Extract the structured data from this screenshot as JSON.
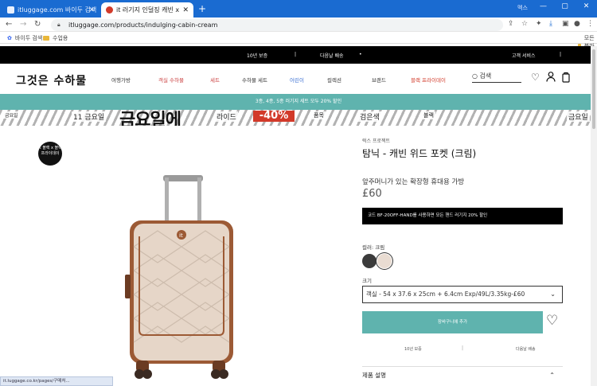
{
  "browser": {
    "tabs": [
      {
        "title": "itluggage.com 바이두 검색",
        "active": false
      },
      {
        "title": "it 러기지 인덜징 캐빈 x",
        "active": true
      }
    ],
    "new_tab": "+",
    "profile_label": "멕스",
    "window_controls": [
      "—",
      "▢",
      "✕"
    ],
    "url": "itluggage.com/products/indulging-cabin-cream",
    "bookmarks": [
      "바이두 검색",
      "수업용"
    ],
    "bookmarks_right": "모든 북마크",
    "status_url": "it.luggage.co.kr/pages/구매처..."
  },
  "site": {
    "topbar": {
      "left": "10년 보증",
      "sep1": "|",
      "center": "다음날 배송",
      "dot": "•",
      "right": "고객 서비스",
      "sep2": "|"
    },
    "logo": "그것은 수하물",
    "nav": [
      "여행가방",
      "객실 수하물",
      "세트",
      "수하물 세트",
      "어린이",
      "컬렉션",
      "브랜드",
      "블랙 프라이데이"
    ],
    "search_placeholder": "검색",
    "promo": "3종, 4종, 5종 러기지 세트 모두 20% 할인",
    "banner_words": [
      "금요일",
      "11 금요일",
      "금요일에",
      "라이드",
      "-40%",
      "품목",
      "검은색",
      "블랙",
      "금요일"
    ]
  },
  "product": {
    "badge": "it 블랙 x 블랙 프라이데이",
    "brand_line": "럭스 프로젝트",
    "title": "탐닉 - 캐빈 위드 포켓 (크림)",
    "description": "앞주머니가 있는 확장형 휴대용 가방",
    "price": "£60",
    "code_bar": "코드 BF-20OFF-HAND를 사용하면 모든 핸드 러기지 20% 할인",
    "color_label": "컬러: 크림",
    "colors": [
      {
        "name": "black",
        "hex": "#3b3b3b"
      },
      {
        "name": "cream",
        "hex": "#e9dcd2"
      }
    ],
    "size_label": "크기",
    "size_value": "객실 - 54 x 37.6 x 25cm + 6.4cm Exp/49L/3.35kg-£60",
    "add_to_cart": "장바구니에 추가",
    "guarantee_left": "10년 보증",
    "guarantee_sep": "|",
    "guarantee_right": "다음날 배송",
    "description_section": "제품 설명"
  },
  "colors": {
    "accent": "#5fb3ae",
    "browser_blue": "#1a6bd1",
    "black": "#000000"
  }
}
